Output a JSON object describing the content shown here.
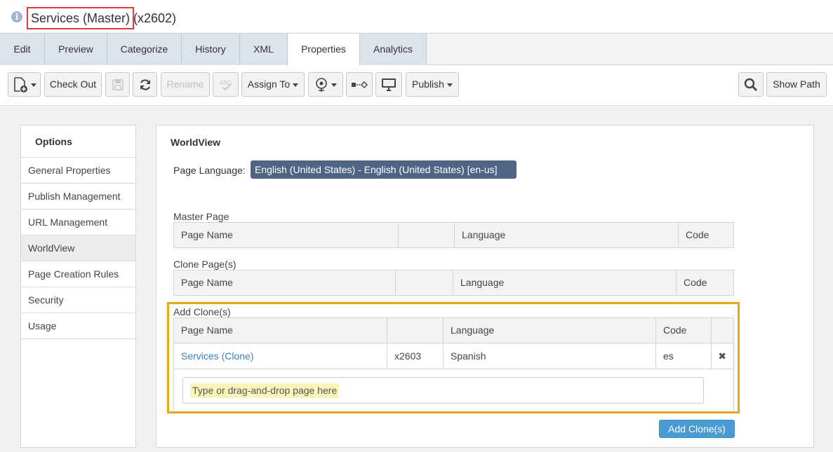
{
  "header": {
    "title": "Services (Master)",
    "id_suffix": "(x2602)"
  },
  "tabs": [
    {
      "label": "Edit"
    },
    {
      "label": "Preview"
    },
    {
      "label": "Categorize"
    },
    {
      "label": "History"
    },
    {
      "label": "XML"
    },
    {
      "label": "Properties",
      "active": true
    },
    {
      "label": "Analytics"
    }
  ],
  "toolbar": {
    "check_out": "Check Out",
    "rename": "Rename",
    "assign_to": "Assign To",
    "publish": "Publish",
    "show_path": "Show Path"
  },
  "options": {
    "title": "Options",
    "items": [
      "General Properties",
      "Publish Management",
      "URL Management",
      "WorldView",
      "Page Creation Rules",
      "Security",
      "Usage"
    ],
    "active": "WorldView"
  },
  "panel": {
    "title": "WorldView",
    "page_language_label": "Page Language:",
    "page_language_value": "English (United States) - English (United States) [en-us]",
    "master_label": "Master Page",
    "clone_label": "Clone Page(s)",
    "add_label": "Add Clone(s)",
    "columns": {
      "page_name": "Page Name",
      "blank": "",
      "language": "Language",
      "code": "Code"
    },
    "add_rows": [
      {
        "page_name": "Services (Clone)",
        "id": "x2603",
        "language": "Spanish",
        "code": "es"
      }
    ],
    "drop_placeholder": "Type or drag-and-drop page here",
    "add_button": "Add Clone(s)"
  },
  "colors": {
    "highlight": "#e8a71a",
    "title_box": "#e03a3a",
    "language_badge": "#4f6586",
    "primary_button": "#4a9ad4",
    "link": "#3a7fc2"
  }
}
